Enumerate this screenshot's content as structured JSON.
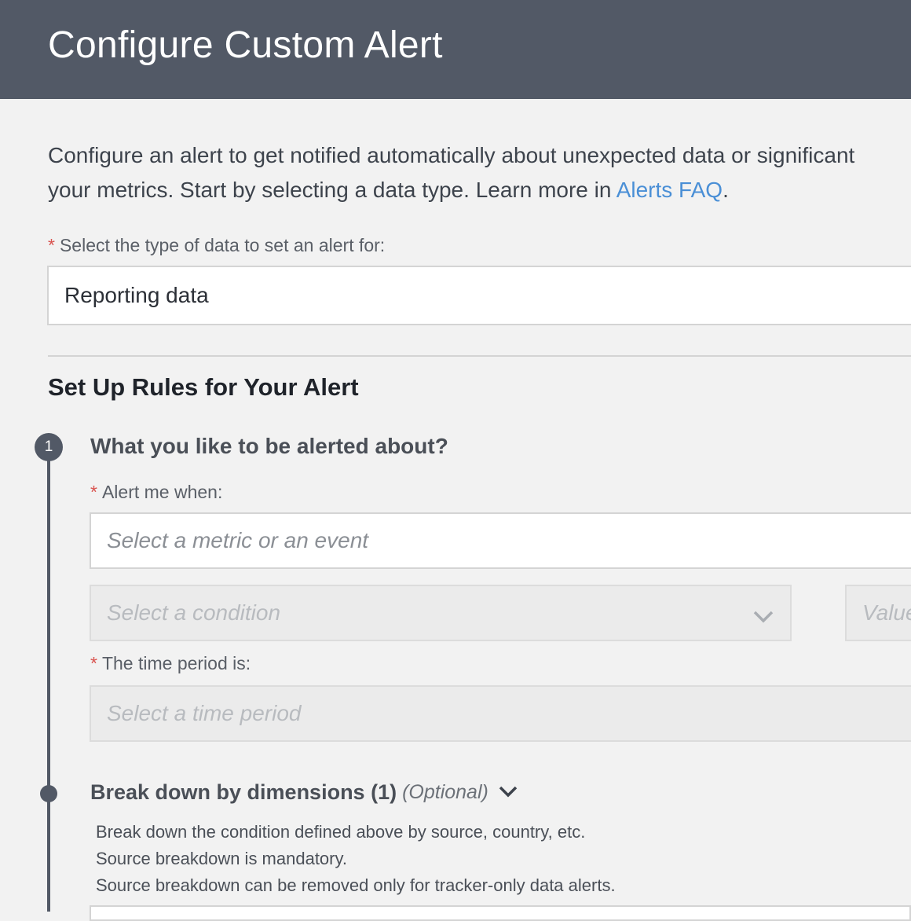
{
  "header": {
    "title": "Configure Custom Alert"
  },
  "intro": {
    "line1": "Configure an alert to get notified automatically about unexpected data or significant",
    "line2_prefix": "your metrics. Start by selecting a data type. Learn more in ",
    "link": "Alerts FAQ",
    "line2_suffix": "."
  },
  "data_type": {
    "required_mark": "*",
    "label": "Select the type of data to set an alert for:",
    "value": "Reporting data"
  },
  "rules": {
    "title": "Set Up Rules for Your Alert"
  },
  "step1": {
    "number": "1",
    "title": "What you like to be alerted about?",
    "alert_label": "Alert me when:",
    "metric_placeholder": "Select a metric or an event",
    "condition_placeholder": "Select a condition",
    "value_placeholder": "Value",
    "period_label": "The time period is:",
    "period_placeholder": "Select a time period"
  },
  "breakdown": {
    "title": "Break down by dimensions (1)",
    "optional": "(Optional)",
    "desc1": "Break down the condition defined above by source, country, etc.",
    "desc2": "Source breakdown is mandatory.",
    "desc3": "Source breakdown can be removed only for tracker-only data alerts."
  },
  "colors": {
    "header_bg": "#525966",
    "link": "#4a8fd6",
    "required": "#d9534f",
    "timeline": "#525966"
  }
}
